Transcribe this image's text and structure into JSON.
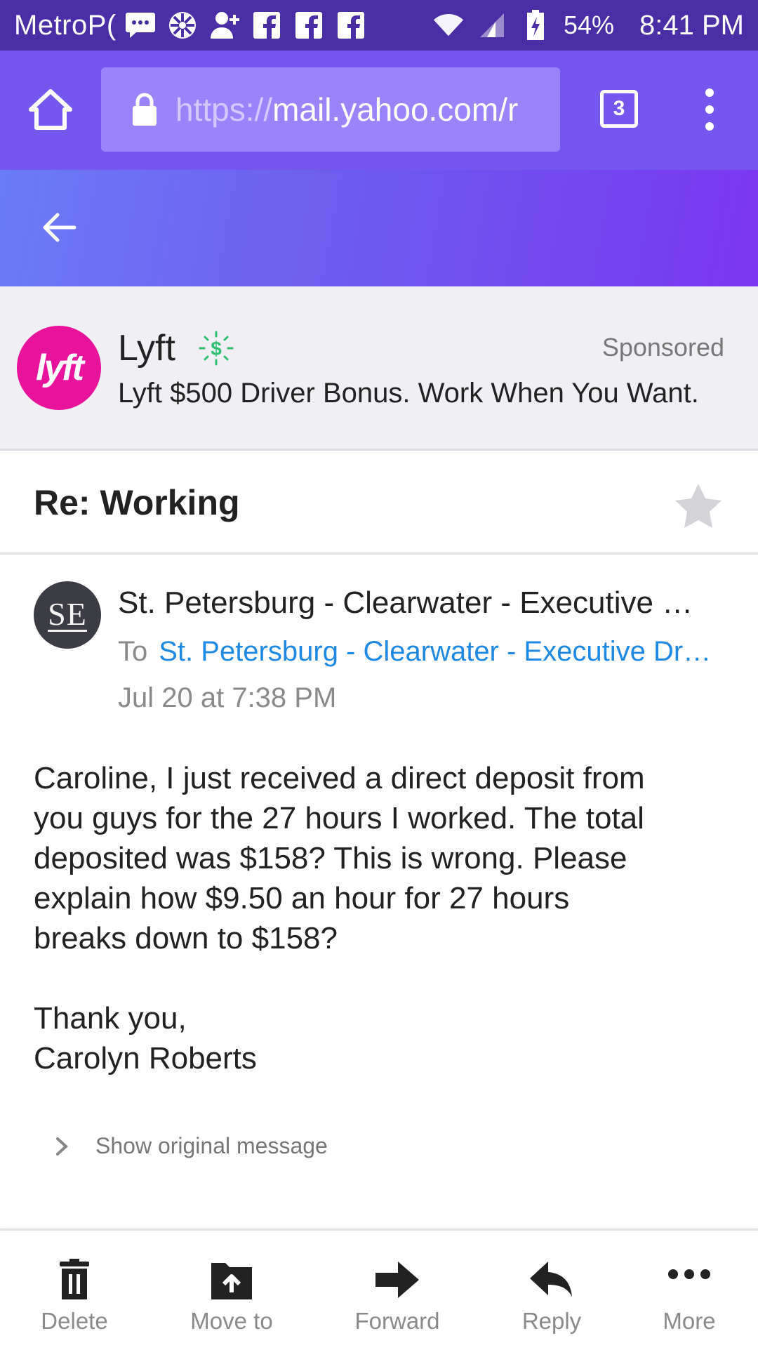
{
  "status_bar": {
    "carrier": "MetroP(",
    "battery": "54%",
    "time": "8:41 PM",
    "icons": [
      "message-icon",
      "settings-wheel-icon",
      "person-add-icon",
      "facebook-icon",
      "facebook-icon",
      "facebook-icon",
      "wifi-icon",
      "signal-icon",
      "battery-charging-icon"
    ]
  },
  "browser": {
    "url_scheme": "https://",
    "url_host": "mail.yahoo.com/r",
    "tab_count": "3"
  },
  "ad": {
    "name": "Lyft",
    "logo_text": "lyft",
    "sponsored_label": "Sponsored",
    "text": "Lyft $500 Driver Bonus. Work When You Want.",
    "logo_color": "#e8129c"
  },
  "message": {
    "subject": "Re: Working",
    "avatar_initials": "SE",
    "sender": "St. Petersburg - Clearwater - Executive …",
    "to_label": "To",
    "to_address": "St. Petersburg - Clearwater - Executive Dr…",
    "date": "Jul 20 at 7:38 PM",
    "body_lines": [
      "Caroline, I just received a direct deposit from",
      "you guys for the 27 hours I worked. The total",
      "deposited was $158? This is wrong. Please",
      "explain how $9.50 an hour for 27 hours",
      "breaks down to $158?"
    ],
    "signoff": "Thank you,",
    "signature": "Carolyn Roberts",
    "show_original_label": "Show original message"
  },
  "toolbar": {
    "delete_label": "Delete",
    "move_label": "Move to",
    "forward_label": "Forward",
    "reply_label": "Reply",
    "more_label": "More"
  },
  "colors": {
    "status_bar": "#4a2ea6",
    "browser_bar": "#7557f0",
    "link_blue": "#1e88e5"
  }
}
